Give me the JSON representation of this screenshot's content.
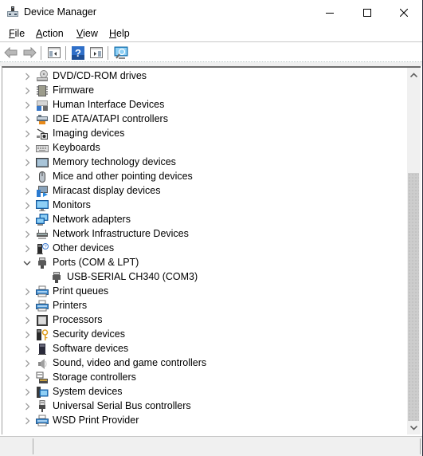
{
  "window": {
    "title": "Device Manager",
    "controls": {
      "minimize": "minimize",
      "maximize": "maximize",
      "close": "close"
    }
  },
  "menu": [
    {
      "label": "File",
      "accel": "F",
      "rest": "ile"
    },
    {
      "label": "Action",
      "accel": "A",
      "rest": "ction"
    },
    {
      "label": "View",
      "accel": "V",
      "rest": "iew"
    },
    {
      "label": "Help",
      "accel": "H",
      "rest": "elp"
    }
  ],
  "toolbar": {
    "buttons": [
      {
        "name": "back",
        "icon": "back-arrow-icon"
      },
      {
        "name": "forward",
        "icon": "forward-arrow-icon"
      },
      {
        "name": "show-hide-console-tree",
        "icon": "console-tree-icon"
      },
      {
        "name": "help",
        "icon": "help-icon"
      },
      {
        "name": "show-hide-action-pane",
        "icon": "action-pane-icon"
      },
      {
        "name": "scan-for-hardware-changes",
        "icon": "scan-hardware-icon"
      }
    ]
  },
  "tree": {
    "items": [
      {
        "label": "DVD/CD-ROM drives",
        "icon": "dvd-drive-icon",
        "expanded": false,
        "level": 0
      },
      {
        "label": "Firmware",
        "icon": "firmware-icon",
        "expanded": false,
        "level": 0
      },
      {
        "label": "Human Interface Devices",
        "icon": "hid-icon",
        "expanded": false,
        "level": 0
      },
      {
        "label": "IDE ATA/ATAPI controllers",
        "icon": "ide-controller-icon",
        "expanded": false,
        "level": 0
      },
      {
        "label": "Imaging devices",
        "icon": "camera-icon",
        "expanded": false,
        "level": 0
      },
      {
        "label": "Keyboards",
        "icon": "keyboard-icon",
        "expanded": false,
        "level": 0
      },
      {
        "label": "Memory technology devices",
        "icon": "memory-icon",
        "expanded": false,
        "level": 0
      },
      {
        "label": "Mice and other pointing devices",
        "icon": "mouse-icon",
        "expanded": false,
        "level": 0
      },
      {
        "label": "Miracast display devices",
        "icon": "miracast-icon",
        "expanded": false,
        "level": 0
      },
      {
        "label": "Monitors",
        "icon": "monitor-icon",
        "expanded": false,
        "level": 0
      },
      {
        "label": "Network adapters",
        "icon": "network-adapter-icon",
        "expanded": false,
        "level": 0
      },
      {
        "label": "Network Infrastructure Devices",
        "icon": "network-infra-icon",
        "expanded": false,
        "level": 0
      },
      {
        "label": "Other devices",
        "icon": "other-devices-icon",
        "expanded": false,
        "level": 0
      },
      {
        "label": "Ports (COM & LPT)",
        "icon": "port-icon",
        "expanded": true,
        "level": 0
      },
      {
        "label": "USB-SERIAL CH340 (COM3)",
        "icon": "port-icon",
        "expanded": null,
        "level": 1
      },
      {
        "label": "Print queues",
        "icon": "printer-icon",
        "expanded": false,
        "level": 0
      },
      {
        "label": "Printers",
        "icon": "printer-icon",
        "expanded": false,
        "level": 0
      },
      {
        "label": "Processors",
        "icon": "processor-icon",
        "expanded": false,
        "level": 0
      },
      {
        "label": "Security devices",
        "icon": "security-device-icon",
        "expanded": false,
        "level": 0
      },
      {
        "label": "Software devices",
        "icon": "software-device-icon",
        "expanded": false,
        "level": 0
      },
      {
        "label": "Sound, video and game controllers",
        "icon": "speaker-icon",
        "expanded": false,
        "level": 0
      },
      {
        "label": "Storage controllers",
        "icon": "storage-controller-icon",
        "expanded": false,
        "level": 0
      },
      {
        "label": "System devices",
        "icon": "system-device-icon",
        "expanded": false,
        "level": 0
      },
      {
        "label": "Universal Serial Bus controllers",
        "icon": "usb-icon",
        "expanded": false,
        "level": 0
      },
      {
        "label": "WSD Print Provider",
        "icon": "printer-icon",
        "expanded": false,
        "level": 0
      }
    ]
  },
  "scrollbar": {
    "position_fraction": 0.27,
    "visible_fraction": 0.73
  },
  "status": {
    "left": "",
    "right": ""
  }
}
